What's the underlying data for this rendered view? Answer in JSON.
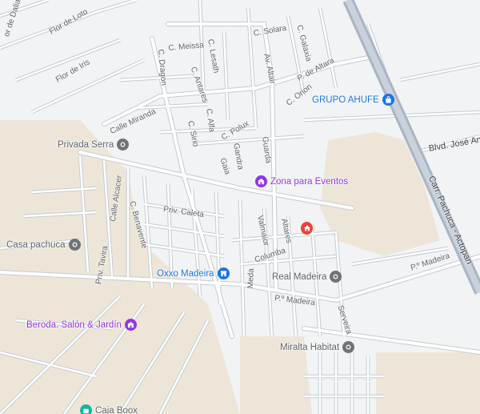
{
  "map": {
    "colors": {
      "background": "#f1f3f4",
      "land_beige": "#ede6d8",
      "road": "#ffffff",
      "road_casing": "#c5cbd3",
      "highway": "#aab5c3",
      "label": "#5f6368",
      "poi_gray": "#6e7378",
      "poi_blue": "#1a73e8",
      "poi_purple": "#9334e6",
      "poi_red": "#ea4335",
      "poi_teal": "#12b5a1"
    },
    "streets": {
      "flor_de_dalia": "or de Dalia",
      "flor_de_loto": "Flor de Loto",
      "flor_de_iris": "Flor de Iris",
      "c_meissa": "C. Meissa",
      "c_lesath": "C. Lesath",
      "c_solara": "C. Solara",
      "c_galaxia": "C. Galaxia",
      "av_altair": "Av. Altair",
      "p_de_altara": "P. de Altara",
      "c_dragon": "C. Dragon",
      "c_antares": "C. Antares",
      "c_orion": "C. Orion",
      "calle_miranda": "Calle Miranda",
      "c_alfa": "C. Alfa",
      "c_sirio": "C. Sirio",
      "c_polux": "C. Polux",
      "gandra": "Gandra",
      "guarda": "Guarda",
      "gaia": "Gaia",
      "calle_alcacer": "Calle Alcacer",
      "c_benavente": "C. Benavente",
      "priv_caleta": "Priv. Caleta",
      "valmaior": "Valmaior",
      "altares": "Altares",
      "columba": "Columba",
      "priv_tavira": "Priv. Tavira",
      "meda": "Meda",
      "p_madeira_1": "P.º Madeira",
      "p_madeira_2": "P.º Madeira",
      "serveira": "Serveira",
      "blvd_jose": "Blvd. José Ant",
      "carr_pachuca": "Carr. Pachuca - Actopan"
    },
    "pois": {
      "grupo_ahufe": {
        "label": "GRUPO AHUFE",
        "icon": "shopping-bag-icon"
      },
      "privada_serra": {
        "label": "Privada Serra",
        "icon": "location-pin-icon"
      },
      "zona_eventos": {
        "label": "Zona para Eventos",
        "icon": "building-icon"
      },
      "red_home": {
        "icon": "home-icon"
      },
      "casa_pachuca": {
        "label": "Casa pachuca",
        "icon": "location-pin-icon"
      },
      "oxxo_madeira": {
        "label": "Oxxo Madeira",
        "icon": "store-icon"
      },
      "real_madeira": {
        "label": "Real Madeira",
        "icon": "location-pin-icon"
      },
      "beroda": {
        "label": "Beroda. Salón & Jardín",
        "icon": "building-icon"
      },
      "miralta": {
        "label": "Miralta Habitat",
        "icon": "location-pin-icon"
      },
      "caja_boox": {
        "label": "Caja Boox",
        "icon": "store-icon"
      }
    }
  }
}
